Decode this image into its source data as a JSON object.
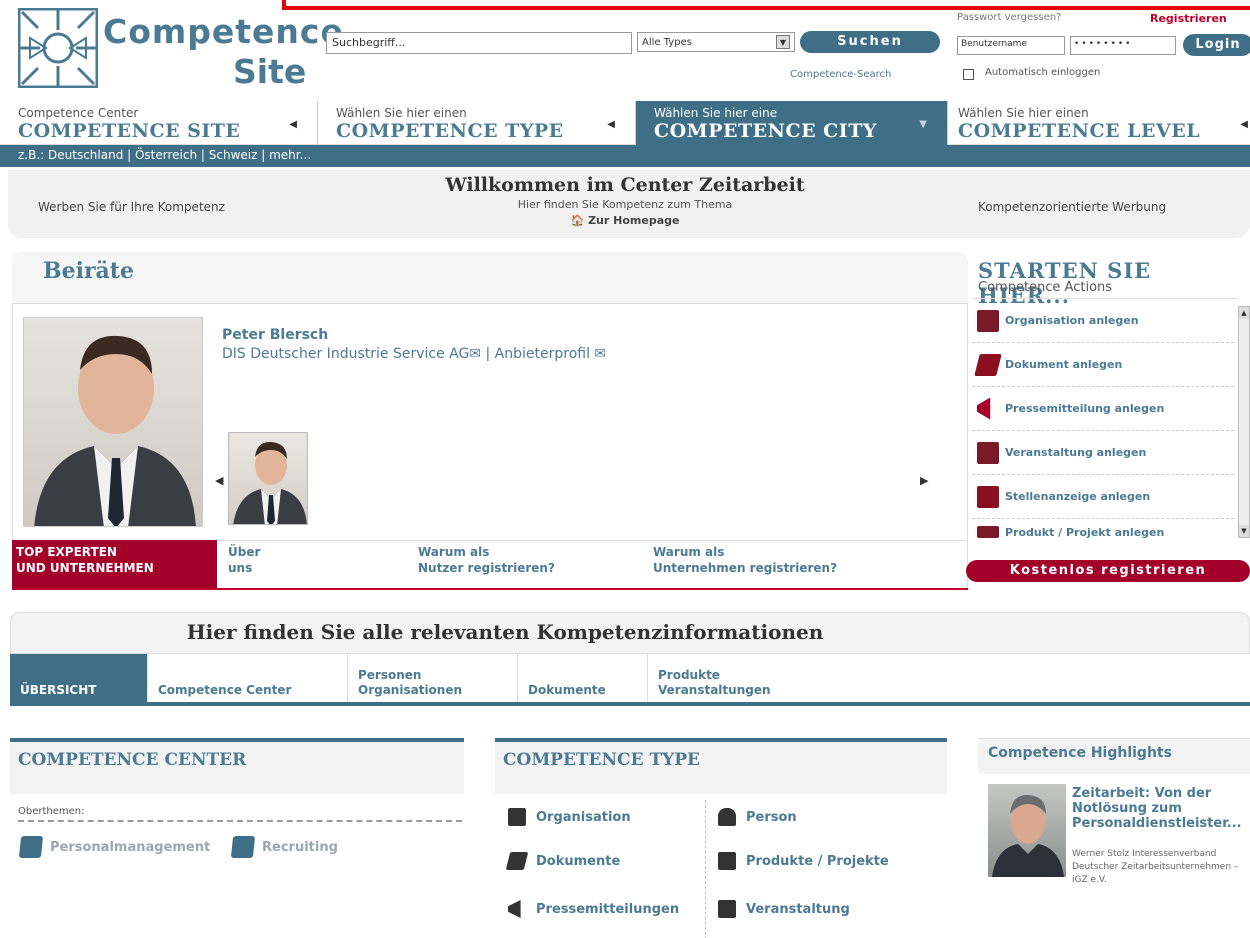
{
  "header": {
    "logo_line1": "Competence",
    "logo_line2": "Site",
    "search_placeholder": "Suchbegriff...",
    "type_select": "Alle Types",
    "search_button": "Suchen",
    "competence_search_link": "Competence-Search",
    "password_forgot": "Passwort vergessen?",
    "register": "Registrieren",
    "username_placeholder": "Benutzername",
    "password_value": "••••••••",
    "login_button": "Login",
    "auto_login_label": "Automatisch einloggen"
  },
  "nav": [
    {
      "sub": "Competence Center",
      "main": "COMPETENCE SITE",
      "arrow": "◀"
    },
    {
      "sub": "Wählen Sie hier einen",
      "main": "COMPETENCE TYPE",
      "arrow": "◀"
    },
    {
      "sub": "Wählen Sie hier eine",
      "main": "COMPETENCE CITY",
      "arrow": "▼"
    },
    {
      "sub": "Wählen Sie hier einen",
      "main": "COMPETENCE LEVEL",
      "arrow": "◀"
    }
  ],
  "country_bar": "z.B.: Deutschland | Österreich | Schweiz | mehr...",
  "welcome": {
    "left": "Werben Sie für Ihre Kompetenz",
    "title": "Willkommen im Center Zeitarbeit",
    "subtitle": "Hier finden Sie Kompetenz zum Thema",
    "home_link": "🏠 Zur Homepage",
    "right": "Kompetenzorientierte Werbung"
  },
  "beirate": {
    "title": "Beiräte",
    "person_name": "Peter Blersch",
    "person_org": "DIS Deutscher Industrie Service AG✉ | Anbieterprofil ✉",
    "tabs": [
      {
        "line1": "TOP EXPERTEN",
        "line2": "UND UNTERNEHMEN"
      },
      {
        "line1": "Über",
        "line2": "uns"
      },
      {
        "line1": "Warum als",
        "line2": "Nutzer registrieren?"
      },
      {
        "line1": "Warum als",
        "line2": "Unternehmen registrieren?"
      }
    ]
  },
  "actions": {
    "title": "STARTEN SIE HIER...",
    "subtitle": "Competence Actions",
    "items": [
      {
        "label": "Organisation anlegen",
        "icon": "building-icon"
      },
      {
        "label": "Dokument anlegen",
        "icon": "document-icon"
      },
      {
        "label": "Pressemitteilung anlegen",
        "icon": "megaphone-icon"
      },
      {
        "label": "Veranstaltung anlegen",
        "icon": "calendar-icon"
      },
      {
        "label": "Stellenanzeige anlegen",
        "icon": "briefcase-icon"
      },
      {
        "label": "Produkt / Projekt anlegen",
        "icon": "product-icon"
      }
    ],
    "register_button": "Kostenlos registrieren"
  },
  "info": {
    "title": "Hier finden Sie alle relevanten Kompetenzinformationen",
    "tabs": [
      {
        "line1": "",
        "line2": "ÜBERSICHT"
      },
      {
        "line1": "",
        "line2": "Competence Center"
      },
      {
        "line1": "Personen",
        "line2": "Organisationen"
      },
      {
        "line1": "",
        "line2": "Dokumente"
      },
      {
        "line1": "Produkte",
        "line2": "Veranstaltungen"
      }
    ]
  },
  "competence_center": {
    "title": "COMPETENCE CENTER",
    "oberthemen": "Oberthemen:",
    "items": [
      "Personalmanagement",
      "Recruiting"
    ]
  },
  "competence_type": {
    "title": "COMPETENCE TYPE",
    "items": [
      "Organisation",
      "Person",
      "Dokumente",
      "Produkte / Projekte",
      "Pressemitteilungen",
      "Veranstaltung"
    ]
  },
  "highlights": {
    "title": "Competence Highlights",
    "article_title": "Zeitarbeit: Von der Notlösung zum Personaldienstleister...",
    "article_meta": "Werner Stolz Interessenverband Deutscher Zeitarbeitsunternehmen – iGZ e.V."
  },
  "colors": {
    "brand_blue": "#3f6e87",
    "accent_red": "#a3002a",
    "frame_red": "#e8000b"
  }
}
